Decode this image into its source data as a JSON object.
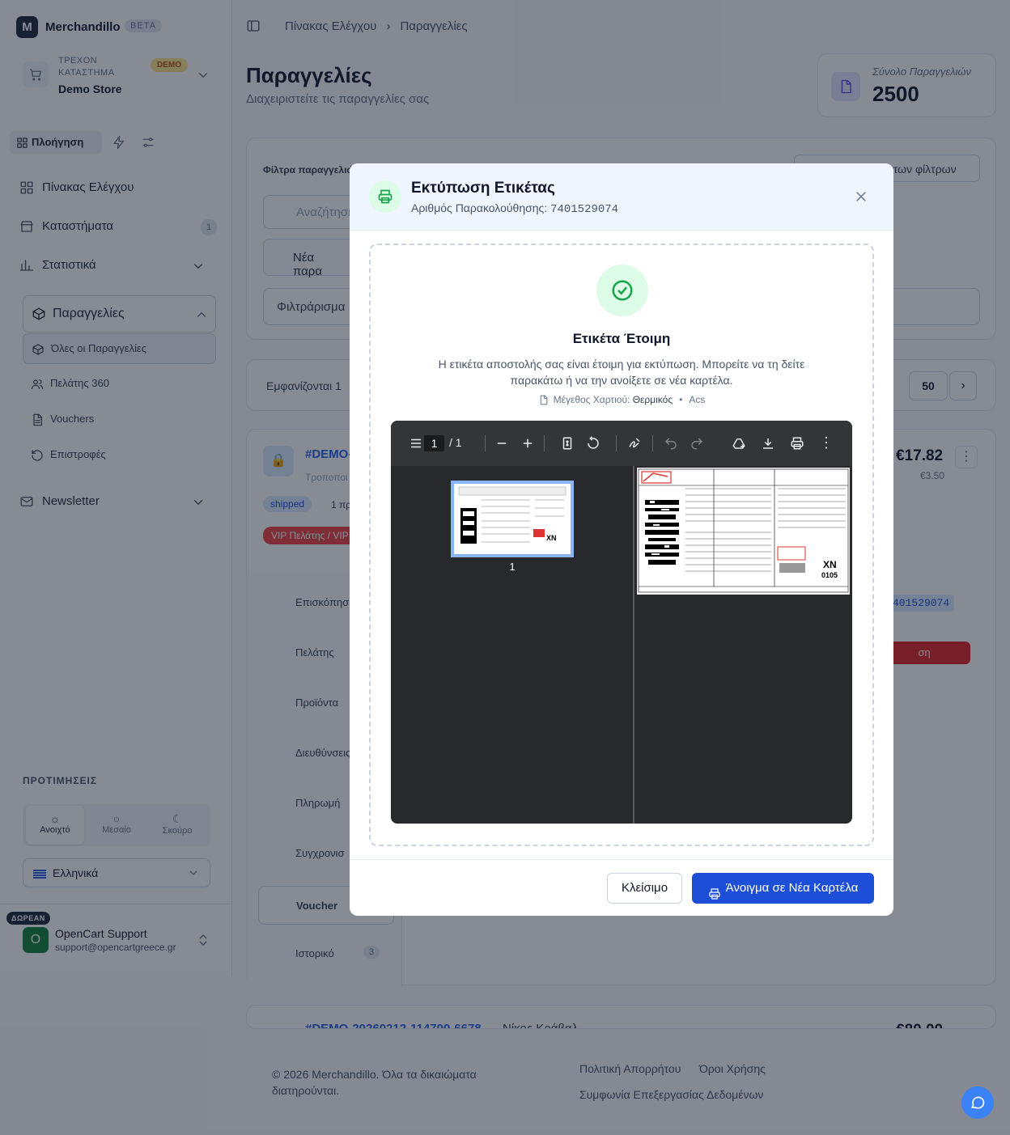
{
  "sidebar": {
    "brand": "Merchandillo",
    "beta": "BETA",
    "store_label": "ΤΡΕΧΟΝ ΚΑΤΑΣΤΗΜΑ",
    "store_name": "Demo Store",
    "store_badge": "DEMO",
    "nav_tab": "Πλοήγηση",
    "items": [
      {
        "label": "Πίνακας Ελέγχου"
      },
      {
        "label": "Καταστήματα",
        "count": "1"
      },
      {
        "label": "Στατιστικά"
      },
      {
        "label": "Παραγγελίες"
      },
      {
        "label": "Newsletter"
      }
    ],
    "sub_items": [
      {
        "label": "Όλες οι Παραγγελίες"
      },
      {
        "label": "Πελάτης 360"
      },
      {
        "label": "Vouchers"
      },
      {
        "label": "Επιστροφές"
      }
    ],
    "prefs_label": "ΠΡΟΤΙΜΗΣΕΙΣ",
    "themes": [
      "Ανοιχτό",
      "Μεσαίο",
      "Σκούρο"
    ],
    "language": "Ελληνικά",
    "support": {
      "badge": "ΔΩΡΕΑΝ",
      "avatar": "O",
      "name": "OpenCart Support",
      "email": "support@opencartgreece.gr"
    }
  },
  "header": {
    "breadcrumb": [
      "Πίνακας Ελέγχου",
      "Παραγγελίες"
    ],
    "title": "Παραγγελίες",
    "subtitle": "Διαχειριστείτε τις παραγγελίες σας",
    "stat_label": "Σύνολο Παραγγελιών",
    "stat_value": "2500"
  },
  "background": {
    "filters_title": "Φίλτρα παραγγελιών",
    "clear_filters": "ών των φίλτρων",
    "search_placeholder": "Αναζήτηση",
    "new_order": "Νέα παρα",
    "filter_select": "Φιλτράρισμα",
    "showing": "Εμφανίζονται 1",
    "per_page": "50",
    "order_id": "#DEMO-",
    "order_sub": "Τροποποι",
    "status": "shipped",
    "status_more": "1 πρ",
    "vip": "VIP Πελάτης / VIP",
    "price": "€17.82",
    "price_sub": "€3.50",
    "tabs": [
      "Επισκόπηση",
      "Πελάτης",
      "Προϊόντα",
      "Διευθύνσεις",
      "Πληρωμή",
      "Συγχρονισ",
      "Voucher",
      "Ιστορικό"
    ],
    "history_count": "3",
    "tracking": "401529074",
    "next_order": "#DEMO-20260212-114700-6678",
    "next_name": "Νίκος Κράβαλ...",
    "next_price": "€80.00",
    "footer_copy": "© 2026 Merchandillo. Όλα τα δικαιώματα διατηρούνται.",
    "footer_links": [
      "Πολιτική Απορρήτου",
      "Όροι Χρήσης",
      "Συμφωνία Επεξεργασίας Δεδομένων"
    ]
  },
  "modal": {
    "title": "Εκτύπωση Ετικέτας",
    "tracking_label": "Αριθμός Παρακολούθησης:",
    "tracking_number": "7401529074",
    "ready_title": "Ετικέτα Έτοιμη",
    "ready_text": "Η ετικέτα αποστολής σας είναι έτοιμη για εκτύπωση. Μπορείτε να τη δείτε παρακάτω ή να την ανοίξετε σε νέα καρτέλα.",
    "paper_label": "Μέγεθος Χαρτιού:",
    "paper_value": "Θερμικός",
    "carrier": "Acs",
    "pdf": {
      "page": "1",
      "total": "/  1",
      "thumb_number": "1"
    },
    "close_button": "Κλείσιμο",
    "open_button": "Άνοιγμα σε Νέα Καρτέλα"
  }
}
